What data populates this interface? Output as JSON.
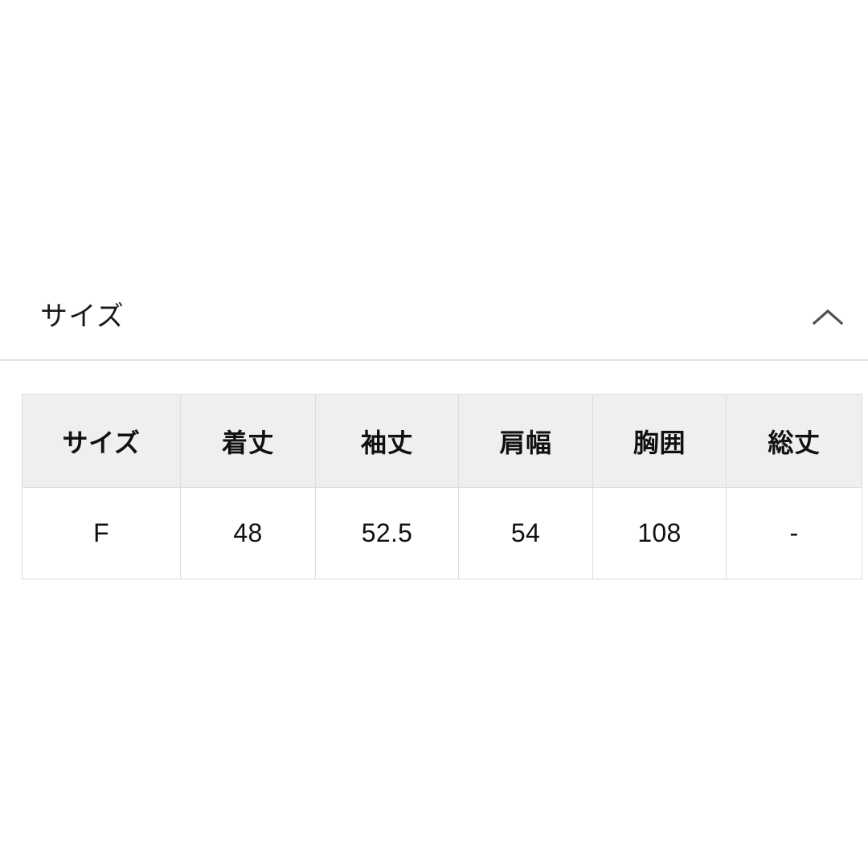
{
  "section": {
    "title": "サイズ",
    "expanded": true,
    "toggle_icon": "chevron-up-icon",
    "divider_color": "#e2e2e2"
  },
  "colors": {
    "page_background": "#ffffff",
    "header_cell_background": "#efefef",
    "table_border": "#dcdcdc",
    "text": "#111111",
    "icon": "#55524a"
  },
  "size_table": {
    "columns": [
      "サイズ",
      "着丈",
      "袖丈",
      "肩幅",
      "胸囲",
      "総丈"
    ],
    "rows": [
      [
        "F",
        "48",
        "52.5",
        "54",
        "108",
        "-"
      ]
    ]
  }
}
